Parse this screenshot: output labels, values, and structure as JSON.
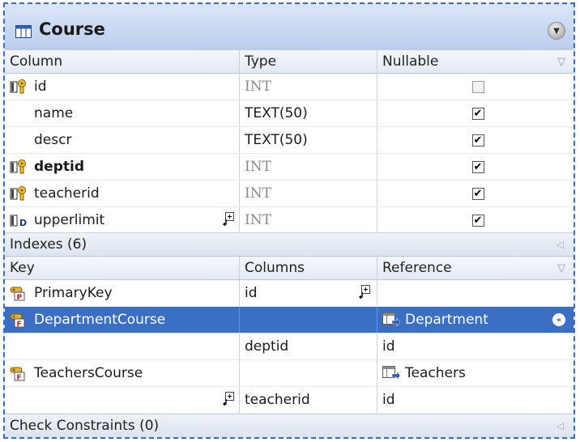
{
  "table": {
    "title": "Course",
    "columns_header": {
      "column": "Column",
      "type": "Type",
      "nullable": "Nullable"
    },
    "columns": [
      {
        "name": "id",
        "type": "INT",
        "nullable": false,
        "icon": "primary-foreign-key-icon",
        "bold": false
      },
      {
        "name": "name",
        "type": "TEXT(50)",
        "nullable": true,
        "icon": "",
        "bold": false
      },
      {
        "name": "descr",
        "type": "TEXT(50)",
        "nullable": true,
        "icon": "",
        "bold": false
      },
      {
        "name": "deptid",
        "type": "INT",
        "nullable": true,
        "icon": "primary-foreign-key-icon",
        "bold": true
      },
      {
        "name": "teacherid",
        "type": "INT",
        "nullable": true,
        "icon": "primary-foreign-key-icon",
        "bold": false
      },
      {
        "name": "upperlimit",
        "type": "INT",
        "nullable": true,
        "icon": "default-value-icon",
        "bold": false
      }
    ]
  },
  "indexes": {
    "label": "Indexes (6)",
    "header": {
      "key": "Key",
      "columns": "Columns",
      "reference": "Reference"
    },
    "rows": [
      {
        "key": "PrimaryKey",
        "columns": "id",
        "reference": "",
        "icon": "primary-key-icon",
        "selected": false
      },
      {
        "key": "DepartmentCourse",
        "columns": "",
        "reference": "Department",
        "icon": "foreign-key-icon",
        "selected": true
      },
      {
        "key": "",
        "columns": "deptid",
        "reference": "id",
        "icon": "",
        "selected": false
      },
      {
        "key": "TeachersCourse",
        "columns": "",
        "reference": "Teachers",
        "icon": "foreign-key-icon",
        "selected": false
      },
      {
        "key": "",
        "columns": "teacherid",
        "reference": "id",
        "icon": "",
        "selected": false
      }
    ]
  },
  "check_constraints": {
    "label": "Check Constraints (0)"
  },
  "colors": {
    "selection": "#3a6fc4",
    "border": "#3a6ad0",
    "header_bg": "#dfe8f6"
  }
}
